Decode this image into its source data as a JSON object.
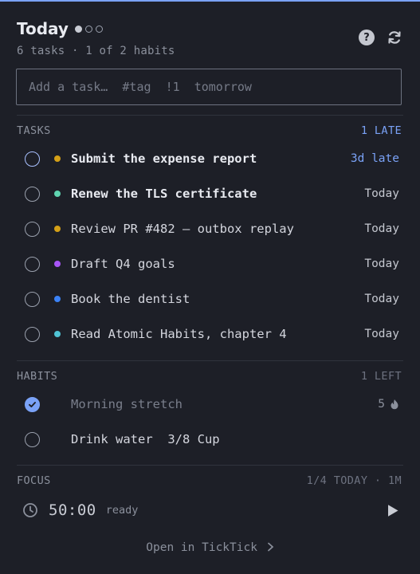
{
  "header": {
    "title": "Today",
    "subtitle": "6 tasks · 1 of 2 habits",
    "page_indicator": {
      "count": 3,
      "active": 0
    }
  },
  "add_task": {
    "placeholder": "Add a task…  #tag  !1  tomorrow"
  },
  "tasks_section": {
    "label": "TASKS",
    "meta": "1 LATE",
    "items": [
      {
        "title": "Submit the expense report",
        "due": "3d late",
        "dot_color": "#d4a017",
        "late": true,
        "bold": true
      },
      {
        "title": "Renew the TLS certificate",
        "due": "Today",
        "dot_color": "#5fd4b0",
        "late": false,
        "bold": true
      },
      {
        "title": "Review PR #482 — outbox replay",
        "due": "Today",
        "dot_color": "#d4a017",
        "late": false,
        "bold": false
      },
      {
        "title": "Draft Q4 goals",
        "due": "Today",
        "dot_color": "#a855f7",
        "late": false,
        "bold": false
      },
      {
        "title": "Book the dentist",
        "due": "Today",
        "dot_color": "#3b82f6",
        "late": false,
        "bold": false
      },
      {
        "title": "Read Atomic Habits, chapter 4",
        "due": "Today",
        "dot_color": "#4fc3d4",
        "late": false,
        "bold": false
      }
    ]
  },
  "habits_section": {
    "label": "HABITS",
    "meta": "1 LEFT",
    "items": [
      {
        "title": "Morning stretch",
        "streak": "5",
        "done": true
      },
      {
        "title": "Drink water  3/8 Cup",
        "done": false
      }
    ]
  },
  "focus_section": {
    "label": "FOCUS",
    "meta": "1/4 TODAY · 1M",
    "timer": "50:00",
    "status": "ready"
  },
  "footer": {
    "link": "Open in TickTick"
  },
  "colors": {
    "accent": "#7aa2f7",
    "background": "#1d1f27"
  }
}
